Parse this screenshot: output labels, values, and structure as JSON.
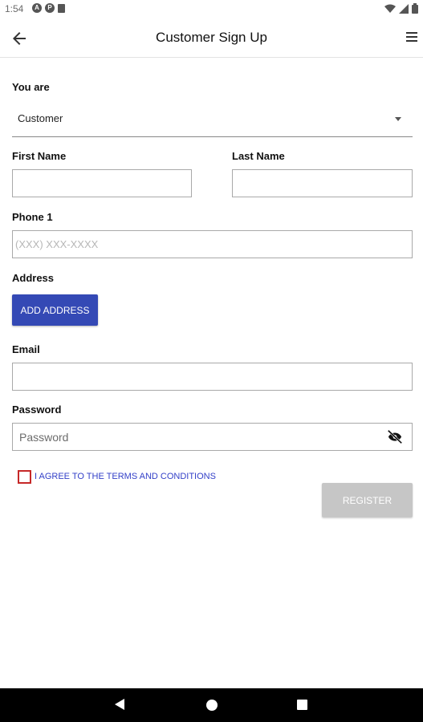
{
  "status_bar": {
    "time": "1:54",
    "icons_left": [
      "a-badge-icon",
      "p-badge-icon",
      "sd-card-icon"
    ],
    "icons_right": [
      "wifi-icon",
      "signal-icon",
      "battery-icon"
    ]
  },
  "app_bar": {
    "title": "Customer Sign Up",
    "back_icon": "arrow-left-icon",
    "menu_icon": "hamburger-menu-icon"
  },
  "form": {
    "you_are_label": "You are",
    "you_are_value": "Customer",
    "first_name_label": "First Name",
    "first_name_value": "",
    "last_name_label": "Last Name",
    "last_name_value": "",
    "phone_label": "Phone 1",
    "phone_placeholder": "(XXX) XXX-XXXX",
    "address_label": "Address",
    "add_address_button": "ADD ADDRESS",
    "email_label": "Email",
    "email_value": "",
    "password_label": "Password",
    "password_placeholder": "Password",
    "terms_text": "I AGREE TO THE TERMS AND CONDITIONS",
    "register_button": "REGISTER"
  },
  "colors": {
    "primary_button": "#3449b5",
    "disabled_button": "#c6c6c6",
    "terms_link": "#3340c8",
    "checkbox_border": "#c62828"
  }
}
